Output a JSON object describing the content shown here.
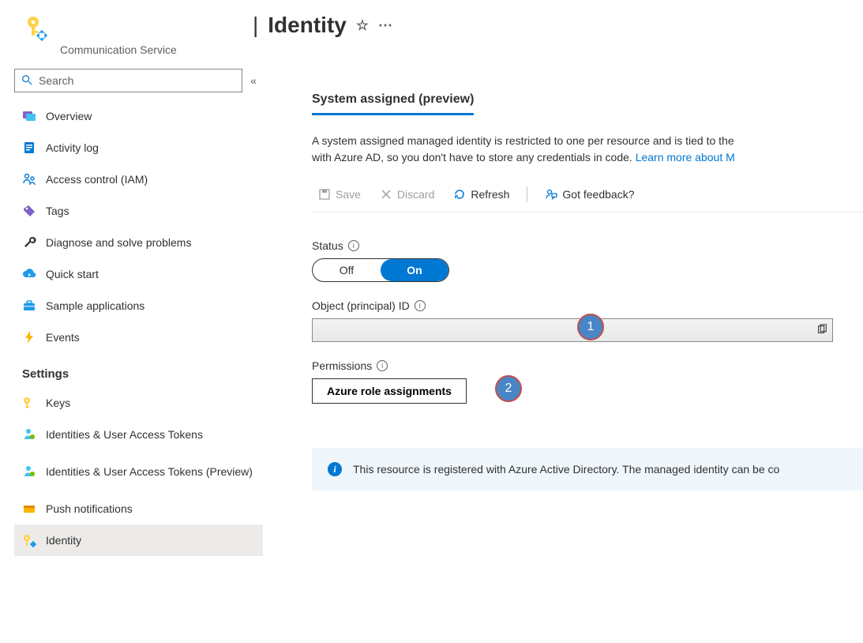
{
  "header": {
    "service_label": "Communication Service",
    "title_pipe": "|",
    "title": "Identity"
  },
  "sidebar": {
    "search_placeholder": "Search",
    "section_settings": "Settings",
    "items": {
      "overview": "Overview",
      "activity": "Activity log",
      "iam": "Access control (IAM)",
      "tags": "Tags",
      "diagnose": "Diagnose and solve problems",
      "quickstart": "Quick start",
      "sample": "Sample applications",
      "events": "Events",
      "keys": "Keys",
      "idtokens": "Identities & User Access Tokens",
      "idtokens_preview": "Identities & User Access Tokens (Preview)",
      "push": "Push notifications",
      "identity": "Identity"
    }
  },
  "main": {
    "tab_label": "System assigned (preview)",
    "desc_part1": "A system assigned managed identity is restricted to one per resource and is tied to the ",
    "desc_part2": "with Azure AD, so you don't have to store any credentials in code. ",
    "desc_link": "Learn more about M",
    "toolbar": {
      "save": "Save",
      "discard": "Discard",
      "refresh": "Refresh",
      "feedback": "Got feedback?"
    },
    "status": {
      "label": "Status",
      "off": "Off",
      "on": "On",
      "value": "on"
    },
    "objectid": {
      "label": "Object (principal) ID",
      "value": ""
    },
    "permissions": {
      "label": "Permissions",
      "button": "Azure role assignments"
    },
    "banner": "This resource is registered with Azure Active Directory. The managed identity can be co"
  },
  "callouts": {
    "c1": "1",
    "c2": "2"
  }
}
